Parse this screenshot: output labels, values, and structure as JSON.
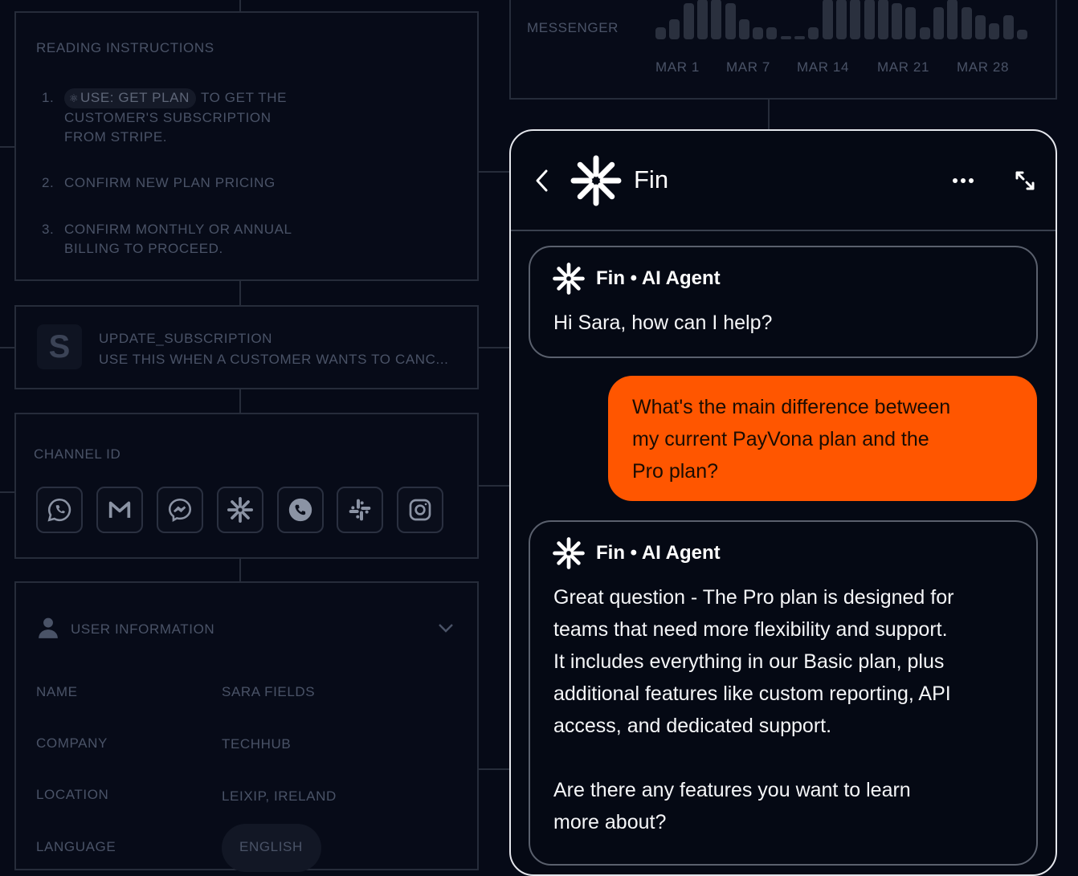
{
  "reading_instructions": {
    "title": "READING INSTRUCTIONS",
    "step1_num": "1.",
    "step1_pill": "USE: GET PLAN",
    "step1_text": "TO GET THE CUSTOMER'S SUBSCRIPTION FROM STRIPE.",
    "step2_num": "2.",
    "step2_text": "CONFIRM NEW PLAN PRICING",
    "step3_num": "3.",
    "step3_text": "CONFIRM MONTHLY OR ANNUAL BILLING TO PROCEED."
  },
  "update_subscription": {
    "icon_letter": "S",
    "name": "UPDATE_SUBSCRIPTION",
    "description": "USE THIS WHEN A CUSTOMER WANTS TO CANC..."
  },
  "channel": {
    "title": "CHANNEL ID",
    "icons": [
      "whatsapp-icon",
      "gmail-icon",
      "messenger-icon",
      "fin-icon",
      "phone-icon",
      "slack-icon",
      "instagram-icon"
    ]
  },
  "user_info": {
    "title": "USER INFORMATION",
    "name_label": "NAME",
    "name_value": "SARA FIELDS",
    "company_label": "COMPANY",
    "company_value": "TECHHUB",
    "location_label": "LOCATION",
    "location_value": "LEIXIP, IRELAND",
    "language_label": "LANGUAGE",
    "language_value": "ENGLISH"
  },
  "messenger_chart": {
    "label": "MESSENGER",
    "dates": [
      "MAR 1",
      "MAR 7",
      "MAR 14",
      "MAR 21",
      "MAR 28"
    ],
    "bar_values": [
      0.3,
      0.5,
      0.9,
      1.0,
      1.0,
      0.9,
      0.5,
      0.3,
      0.3,
      0.08,
      0.08,
      0.3,
      1.0,
      1.0,
      1.0,
      1.0,
      1.0,
      0.9,
      0.8,
      0.3,
      0.8,
      1.0,
      0.8,
      0.6,
      0.4,
      0.6,
      0.25
    ]
  },
  "chat": {
    "title": "Fin",
    "agent_label": "Fin • AI Agent",
    "greeting": "Hi Sara, how can I help?",
    "user_line1": "What's the main difference between",
    "user_line2": "my current PayVona plan and the",
    "user_line3": "Pro plan?",
    "reply_line1": "Great question - The Pro plan is designed for",
    "reply_line2": "teams that need more flexibility and support.",
    "reply_line3": "It includes everything in our Basic plan, plus",
    "reply_line4": "additional features like custom reporting, API",
    "reply_line5": "access, and dedicated support.",
    "reply_line6": "Are there any features you want to learn",
    "reply_line7": "more about?"
  },
  "colors": {
    "accent": "#ff5600",
    "background": "#060a17"
  }
}
